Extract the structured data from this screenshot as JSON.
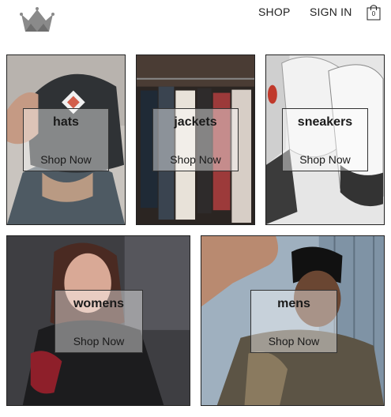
{
  "header": {
    "nav": {
      "shop": "SHOP",
      "sign_in": "SIGN IN"
    },
    "cart": {
      "count": "0"
    }
  },
  "categories": [
    {
      "name": "hats",
      "cta": "Shop Now"
    },
    {
      "name": "jackets",
      "cta": "Shop Now"
    },
    {
      "name": "sneakers",
      "cta": "Shop Now"
    },
    {
      "name": "womens",
      "cta": "Shop Now"
    },
    {
      "name": "mens",
      "cta": "Shop Now"
    }
  ]
}
